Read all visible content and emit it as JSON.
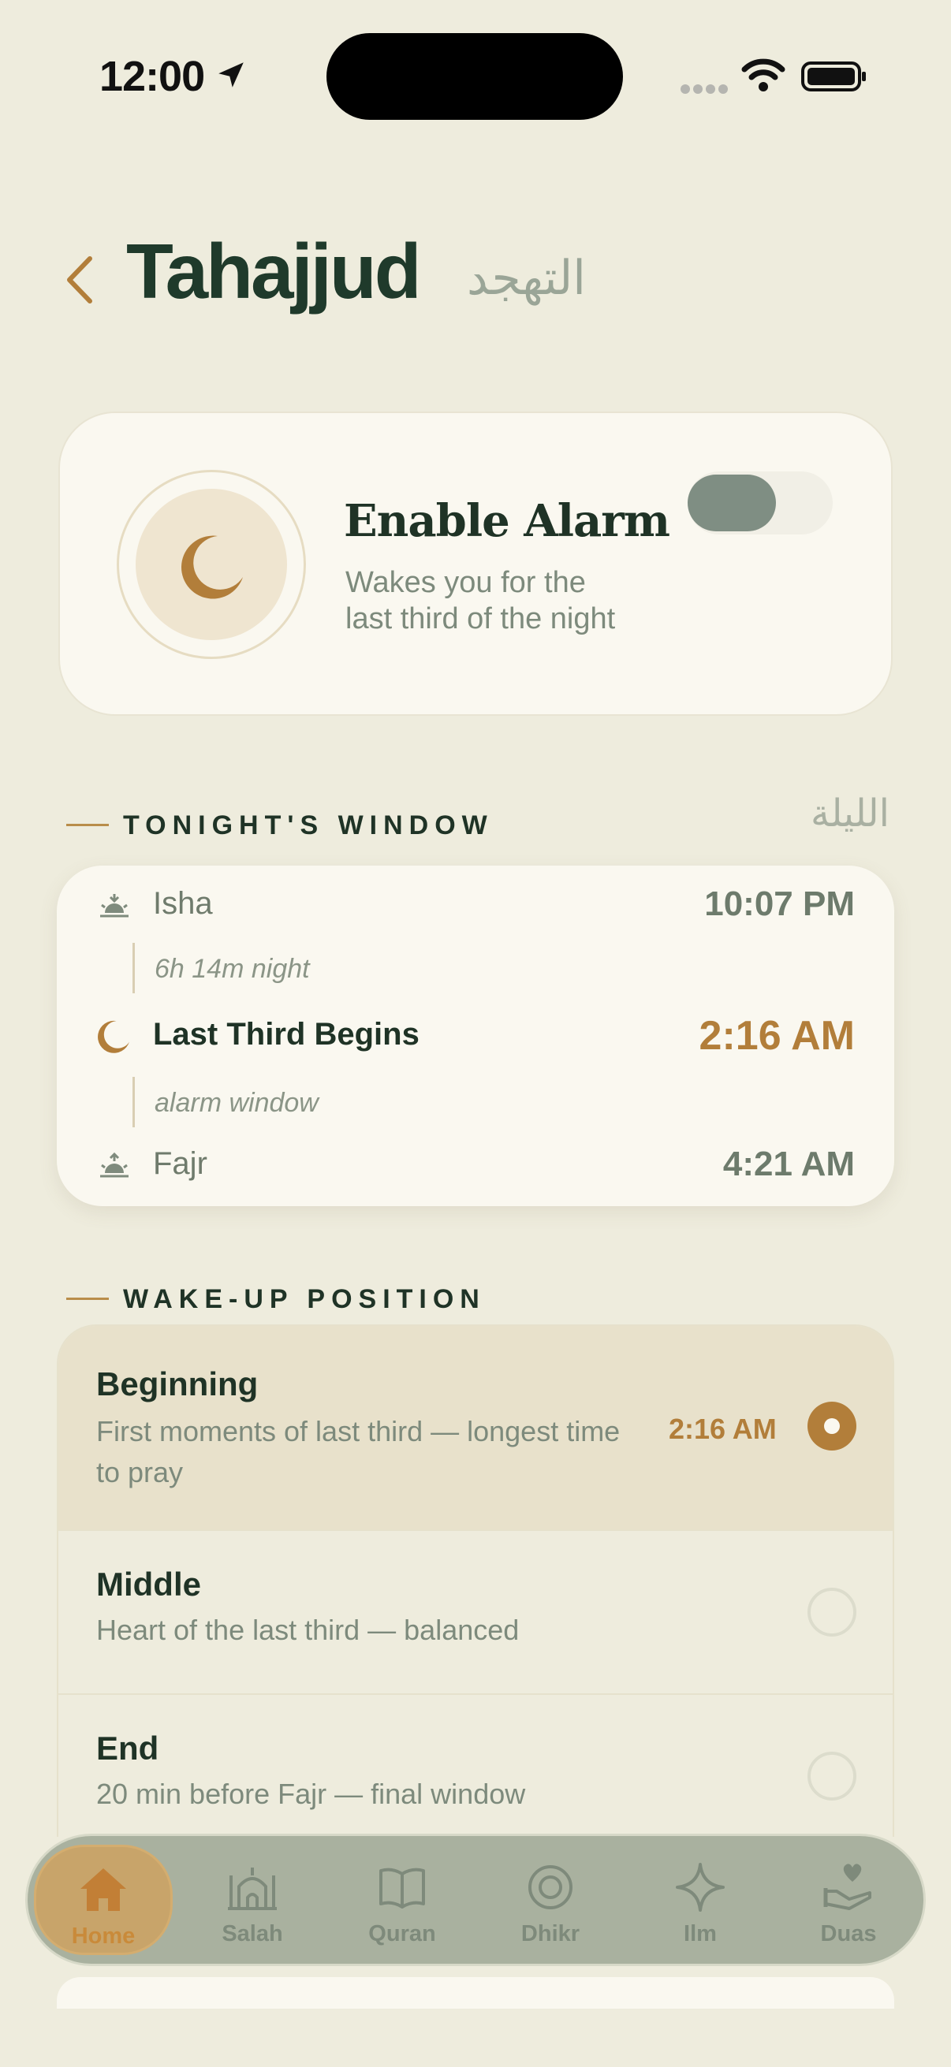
{
  "status": {
    "time": "12:00"
  },
  "header": {
    "title": "Tahajjud",
    "title_ar": "التهجد"
  },
  "alarm": {
    "title": "Enable Alarm",
    "subtitle_line1": "Wakes you for the",
    "subtitle_line2": "last third of the night",
    "enabled": false
  },
  "tonight": {
    "heading": "TONIGHT'S WINDOW",
    "heading_ar": "الليلة",
    "isha": {
      "name": "Isha",
      "time": "10:07 PM"
    },
    "night_length": "6h 14m night",
    "last_third": {
      "name": "Last Third Begins",
      "time": "2:16 AM"
    },
    "alarm_window": "alarm window",
    "fajr": {
      "name": "Fajr",
      "time": "4:21 AM"
    }
  },
  "wake": {
    "heading": "WAKE-UP POSITION",
    "options": [
      {
        "title": "Beginning",
        "desc": "First moments of last third — longest time to pray",
        "time": "2:16 AM",
        "selected": true
      },
      {
        "title": "Middle",
        "desc": "Heart of the last third — balanced",
        "time": "",
        "selected": false
      },
      {
        "title": "End",
        "desc": "20 min before Fajr — final window",
        "time": "",
        "selected": false
      }
    ]
  },
  "tabs": [
    {
      "label": "Home",
      "icon": "home-icon",
      "active": true
    },
    {
      "label": "Salah",
      "icon": "mosque-icon",
      "active": false
    },
    {
      "label": "Quran",
      "icon": "book-icon",
      "active": false
    },
    {
      "label": "Dhikr",
      "icon": "target-icon",
      "active": false
    },
    {
      "label": "Ilm",
      "icon": "sparkle-icon",
      "active": false
    },
    {
      "label": "Duas",
      "icon": "hands-heart-icon",
      "active": false
    }
  ],
  "colors": {
    "accent": "#b27e3a",
    "primary_text": "#1f3326",
    "background": "#eeecdd"
  }
}
